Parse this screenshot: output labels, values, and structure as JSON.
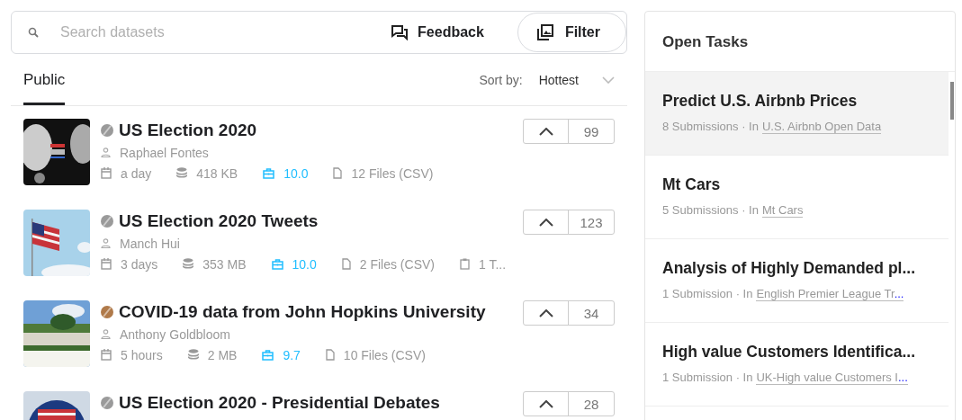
{
  "search": {
    "placeholder": "Search datasets"
  },
  "toolbar": {
    "feedback": "Feedback",
    "filter": "Filter"
  },
  "tabs": [
    {
      "label": "Public",
      "selected": true
    }
  ],
  "sort": {
    "label": "Sort by:",
    "value": "Hottest"
  },
  "datasets": [
    {
      "title": "US Election 2020",
      "color": "#9a9a9a",
      "author": "Raphael Fontes",
      "votes": "99",
      "meta": [
        {
          "kind": "date",
          "text": "a day"
        },
        {
          "kind": "size",
          "text": "418 KB"
        },
        {
          "kind": "usability",
          "text": "10.0"
        },
        {
          "kind": "files",
          "text": "12 Files (CSV)"
        }
      ]
    },
    {
      "title": "US Election 2020 Tweets",
      "color": "#9a9a9a",
      "author": "Manch Hui",
      "votes": "123",
      "meta": [
        {
          "kind": "date",
          "text": "3 days"
        },
        {
          "kind": "size",
          "text": "353 MB"
        },
        {
          "kind": "usability",
          "text": "10.0"
        },
        {
          "kind": "files",
          "text": "2 Files (CSV)"
        },
        {
          "kind": "tasks",
          "text": "1 T..."
        }
      ]
    },
    {
      "title": "COVID-19 data from John Hopkins University",
      "color": "#b07a4a",
      "author": "Anthony Goldbloom",
      "votes": "34",
      "meta": [
        {
          "kind": "date",
          "text": "5 hours"
        },
        {
          "kind": "size",
          "text": "2 MB"
        },
        {
          "kind": "usability",
          "text": "9.7"
        },
        {
          "kind": "files",
          "text": "10 Files (CSV)"
        }
      ]
    },
    {
      "title": "US Election 2020 - Presidential Debates",
      "color": "#9a9a9a",
      "votes": "28"
    }
  ],
  "open_tasks": {
    "title": "Open Tasks",
    "items": [
      {
        "title": "Predict U.S. Airbnb Prices",
        "submissions": "8 Submissions",
        "in": "· In",
        "dataset": "U.S. Airbnb Open Data",
        "selected": true
      },
      {
        "title": "Mt Cars",
        "submissions": "5 Submissions",
        "in": "· In",
        "dataset": "Mt Cars",
        "selected": false
      },
      {
        "title": "Analysis of Highly Demanded pl...",
        "submissions": "1 Submission",
        "in": "· In",
        "dataset": "English Premier League Tr",
        "ellipsis": "...",
        "selected": false
      },
      {
        "title": "High value Customers Identifica...",
        "submissions": "1 Submission",
        "in": "· In",
        "dataset": "UK-High value Customers I",
        "ellipsis": "...",
        "selected": false
      }
    ]
  }
}
